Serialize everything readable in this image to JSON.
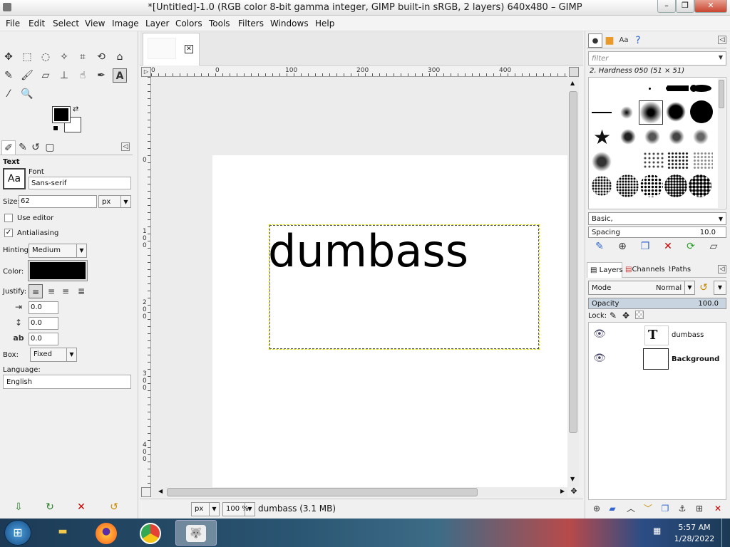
{
  "window": {
    "title": "*[Untitled]-1.0 (RGB color 8-bit gamma integer, GIMP built-in sRGB, 2 layers) 640x480 – GIMP"
  },
  "menu": [
    "File",
    "Edit",
    "Select",
    "View",
    "Image",
    "Layer",
    "Colors",
    "Tools",
    "Filters",
    "Windows",
    "Help"
  ],
  "tool_options": {
    "title": "Text",
    "font_label": "Font",
    "font_value": "Sans-serif",
    "size_label": "Size:",
    "size_value": "62",
    "size_unit": "px",
    "use_editor": "Use editor",
    "antialiasing": "Antialiasing",
    "hinting_label": "Hinting:",
    "hinting_value": "Medium",
    "color_label": "Color:",
    "justify_label": "Justify:",
    "indent": "0.0",
    "line_spacing": "0.0",
    "letter_spacing": "0.0",
    "box_label": "Box:",
    "box_value": "Fixed",
    "language_label": "Language:",
    "language_value": "English"
  },
  "ruler": {
    "h_ticks": [
      "0",
      "100",
      "200",
      "300",
      "400"
    ],
    "v_ticks": [
      "1\n0\n0",
      "0",
      "1\n0\n0",
      "2\n0\n0",
      "3\n0\n0",
      "4\n0\n0"
    ]
  },
  "canvas": {
    "text": "dumbass"
  },
  "statusbar": {
    "unit": "px",
    "zoom": "100 %",
    "info": "dumbass (3.1 MB)"
  },
  "brushes": {
    "filter_placeholder": "filter",
    "current": "2. Hardness 050 (51 × 51)",
    "tag": "Basic,",
    "spacing_label": "Spacing",
    "spacing_value": "10.0"
  },
  "layers": {
    "tabs": [
      "Layers",
      "Channels",
      "Paths"
    ],
    "mode_label": "Mode",
    "mode_value": "Normal",
    "opacity_label": "Opacity",
    "opacity_value": "100.0",
    "lock_label": "Lock:",
    "items": [
      {
        "name": "dumbass"
      },
      {
        "name": "Background"
      }
    ]
  },
  "taskbar": {
    "time": "5:57 AM",
    "date": "1/28/2022"
  }
}
